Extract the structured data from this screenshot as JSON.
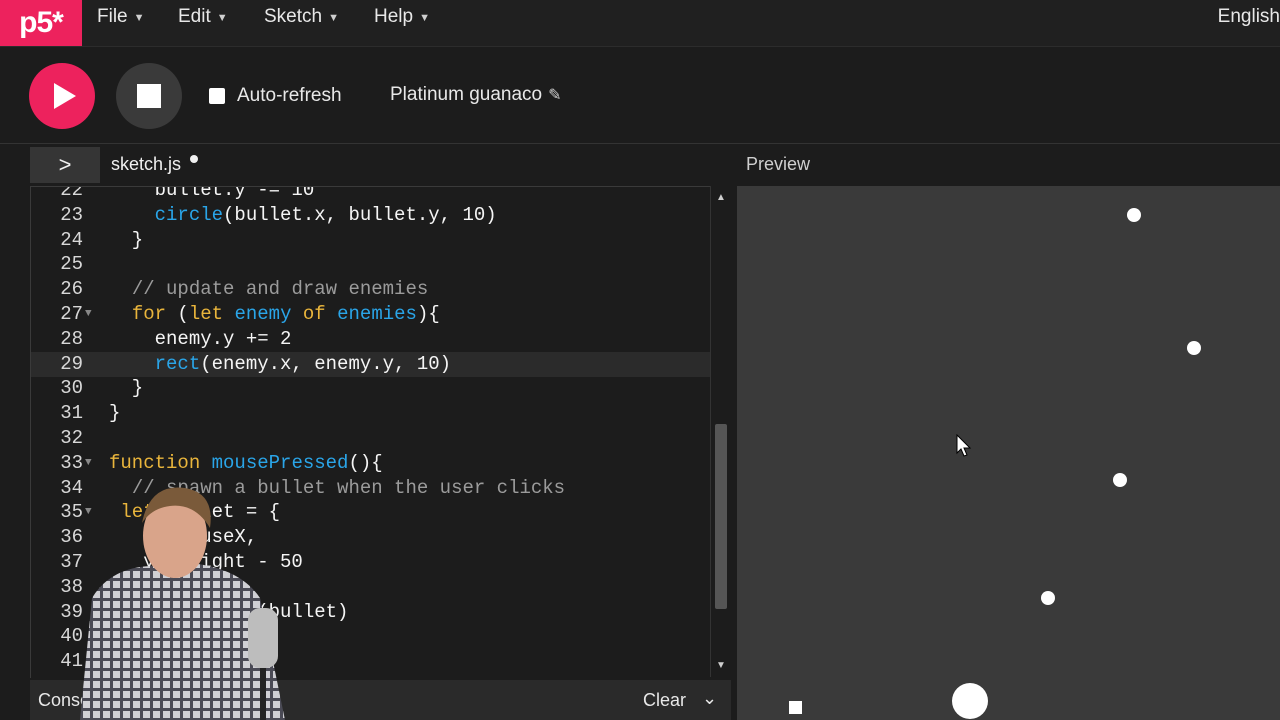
{
  "menu": {
    "logo_text": "p5*",
    "items": [
      {
        "label": "File"
      },
      {
        "label": "Edit"
      },
      {
        "label": "Sketch"
      },
      {
        "label": "Help"
      }
    ],
    "language": "English"
  },
  "toolbar": {
    "autorefresh_label": "Auto-refresh",
    "autorefresh_checked": false,
    "sketch_name": "Platinum guanaco",
    "play_icon": "play-icon",
    "stop_icon": "stop-icon"
  },
  "tabs": {
    "file_name": "sketch.js",
    "preview_label": "Preview"
  },
  "editor": {
    "lines": [
      {
        "n": "22",
        "text": "    bullet.y -= 10"
      },
      {
        "n": "23",
        "text": "    circle(bullet.x, bullet.y, 10)"
      },
      {
        "n": "24",
        "text": "  }"
      },
      {
        "n": "25",
        "text": ""
      },
      {
        "n": "26",
        "text": "  // update and draw enemies"
      },
      {
        "n": "27",
        "text": "  for (let enemy of enemies){"
      },
      {
        "n": "28",
        "text": "    enemy.y += 2"
      },
      {
        "n": "29",
        "text": "    rect(enemy.x, enemy.y, 10)"
      },
      {
        "n": "30",
        "text": "  }"
      },
      {
        "n": "31",
        "text": "}"
      },
      {
        "n": "32",
        "text": ""
      },
      {
        "n": "33",
        "text": "function mousePressed(){"
      },
      {
        "n": "34",
        "text": "  // spawn a bullet when the user clicks"
      },
      {
        "n": "35",
        "text": " let bullet = {"
      },
      {
        "n": "36",
        "text": "   x: mouseX,"
      },
      {
        "n": "37",
        "text": "   y: height - 50"
      },
      {
        "n": "38",
        "text": " }"
      },
      {
        "n": "39",
        "text": " bullets.push(bullet)"
      },
      {
        "n": "40",
        "text": ""
      },
      {
        "n": "41",
        "text": ""
      }
    ],
    "active_line": "29"
  },
  "console": {
    "label": "Console",
    "clear_label": "Clear"
  },
  "colors": {
    "brand": "#ed225d",
    "keyword": "#e9b53c",
    "function": "#2aa5e8",
    "comment": "#9b9b9b"
  }
}
